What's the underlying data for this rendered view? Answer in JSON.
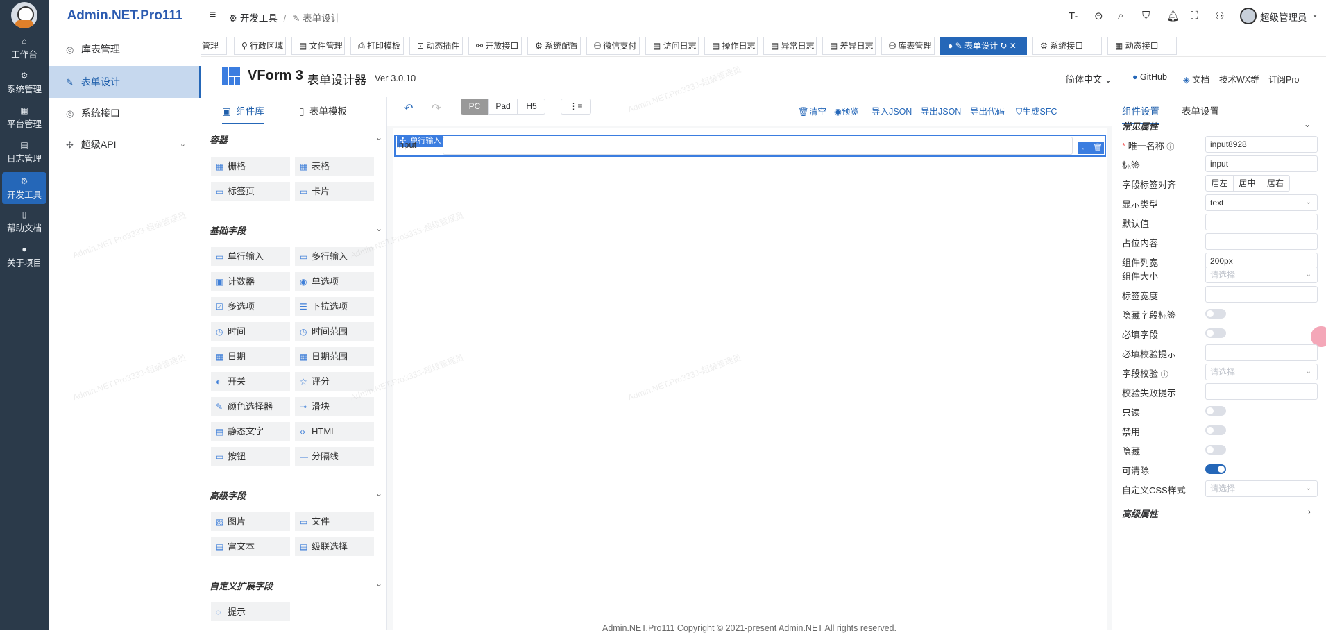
{
  "app": {
    "brand": "Admin.NET.Pro111"
  },
  "rail": {
    "items": [
      {
        "icon": "⌂",
        "label": "工作台"
      },
      {
        "icon": "⚙",
        "label": "系统管理"
      },
      {
        "icon": "▦",
        "label": "平台管理"
      },
      {
        "icon": "▤",
        "label": "日志管理"
      },
      {
        "icon": "⚙",
        "label": "开发工具"
      },
      {
        "icon": "▯",
        "label": "帮助文档"
      },
      {
        "icon": "●",
        "label": "关于项目"
      }
    ]
  },
  "submenu": {
    "items": [
      {
        "icon": "◎",
        "label": "库表管理"
      },
      {
        "icon": "✎",
        "label": "表单设计"
      },
      {
        "icon": "◎",
        "label": "系统接口"
      },
      {
        "icon": "✣",
        "label": "超级API"
      }
    ]
  },
  "header": {
    "breadcrumb_1": "开发工具",
    "breadcrumb_sep": "/",
    "breadcrumb_2": "表单设计",
    "user_name": "超级管理员"
  },
  "tags": [
    {
      "label": "管理"
    },
    {
      "label": "行政区域"
    },
    {
      "label": "文件管理"
    },
    {
      "label": "打印模板"
    },
    {
      "label": "动态插件"
    },
    {
      "label": "开放接口"
    },
    {
      "label": "系统配置"
    },
    {
      "label": "微信支付"
    },
    {
      "label": "访问日志"
    },
    {
      "label": "操作日志"
    },
    {
      "label": "异常日志"
    },
    {
      "label": "差异日志"
    },
    {
      "label": "库表管理"
    },
    {
      "label": "表单设计"
    },
    {
      "label": "系统接口"
    },
    {
      "label": "动态接口"
    }
  ],
  "vform": {
    "title": "VForm 3",
    "subtitle": "表单设计器",
    "version": "Ver 3.0.10",
    "lang": "简体中文",
    "links": [
      "GitHub",
      "文档",
      "技术WX群",
      "订阅Pro"
    ]
  },
  "left_tabs": [
    "组件库",
    "表单模板"
  ],
  "categories": {
    "container": "容器",
    "basic": "基础字段",
    "advanced": "高级字段",
    "custom": "自定义扩展字段"
  },
  "widgets": {
    "container": [
      {
        "icon": "▦",
        "label": "栅格"
      },
      {
        "icon": "▦",
        "label": "表格"
      },
      {
        "icon": "▭",
        "label": "标签页"
      },
      {
        "icon": "▭",
        "label": "卡片"
      }
    ],
    "basic": [
      {
        "icon": "▭",
        "label": "单行输入"
      },
      {
        "icon": "▭",
        "label": "多行输入"
      },
      {
        "icon": "▣",
        "label": "计数器"
      },
      {
        "icon": "◉",
        "label": "单选项"
      },
      {
        "icon": "☑",
        "label": "多选项"
      },
      {
        "icon": "☰",
        "label": "下拉选项"
      },
      {
        "icon": "◷",
        "label": "时间"
      },
      {
        "icon": "◷",
        "label": "时间范围"
      },
      {
        "icon": "▦",
        "label": "日期"
      },
      {
        "icon": "▦",
        "label": "日期范围"
      },
      {
        "icon": "◐",
        "label": "开关"
      },
      {
        "icon": "☆",
        "label": "评分"
      },
      {
        "icon": "✎",
        "label": "颜色选择器"
      },
      {
        "icon": "⊸",
        "label": "滑块"
      },
      {
        "icon": "▤",
        "label": "静态文字"
      },
      {
        "icon": "‹›",
        "label": "HTML"
      },
      {
        "icon": "▭",
        "label": "按钮"
      },
      {
        "icon": "—",
        "label": "分隔线"
      }
    ],
    "advanced": [
      {
        "icon": "▨",
        "label": "图片"
      },
      {
        "icon": "▭",
        "label": "文件"
      },
      {
        "icon": "▤",
        "label": "富文本"
      },
      {
        "icon": "▤",
        "label": "级联选择"
      }
    ],
    "custom": [
      {
        "icon": "◌",
        "label": "提示"
      }
    ]
  },
  "toolbar": {
    "devices": [
      "PC",
      "Pad",
      "H5"
    ],
    "actions": [
      "清空",
      "预览",
      "导入JSON",
      "导出JSON",
      "导出代码",
      "生成SFC"
    ]
  },
  "canvas": {
    "field_label": "input",
    "badge_label": "单行输入"
  },
  "right_tabs": [
    "组件设置",
    "表单设置"
  ],
  "props": {
    "section": "常见属性",
    "section_advanced": "高级属性",
    "unique_name": "唯一名称",
    "unique_name_value": "input8928",
    "label": "标签",
    "label_value": "input",
    "align": "字段标签对齐",
    "align_options": [
      "居左",
      "居中",
      "居右"
    ],
    "display_type": "显示类型",
    "display_type_value": "text",
    "default_value": "默认值",
    "placeholder": "占位内容",
    "column_width": "组件列宽",
    "column_width_value": "200px",
    "size": "组件大小",
    "select_placeholder": "请选择",
    "label_width": "标签宽度",
    "hide_label": "隐藏字段标签",
    "required": "必填字段",
    "required_hint": "必填校验提示",
    "validation": "字段校验",
    "validation_fail": "校验失败提示",
    "readonly": "只读",
    "disabled": "禁用",
    "hidden": "隐藏",
    "clearable": "可清除",
    "custom_css": "自定义CSS样式"
  },
  "footer": {
    "copyright": "Admin.NET.Pro111 Copyright © 2021-present Admin.NET All rights reserved."
  },
  "watermark": "Admin.NET.Pro3333-超级管理员",
  "colors": {
    "accent": "#2567b8",
    "rail": "#2b3a4a",
    "active_menu": "#c6d8ee"
  }
}
